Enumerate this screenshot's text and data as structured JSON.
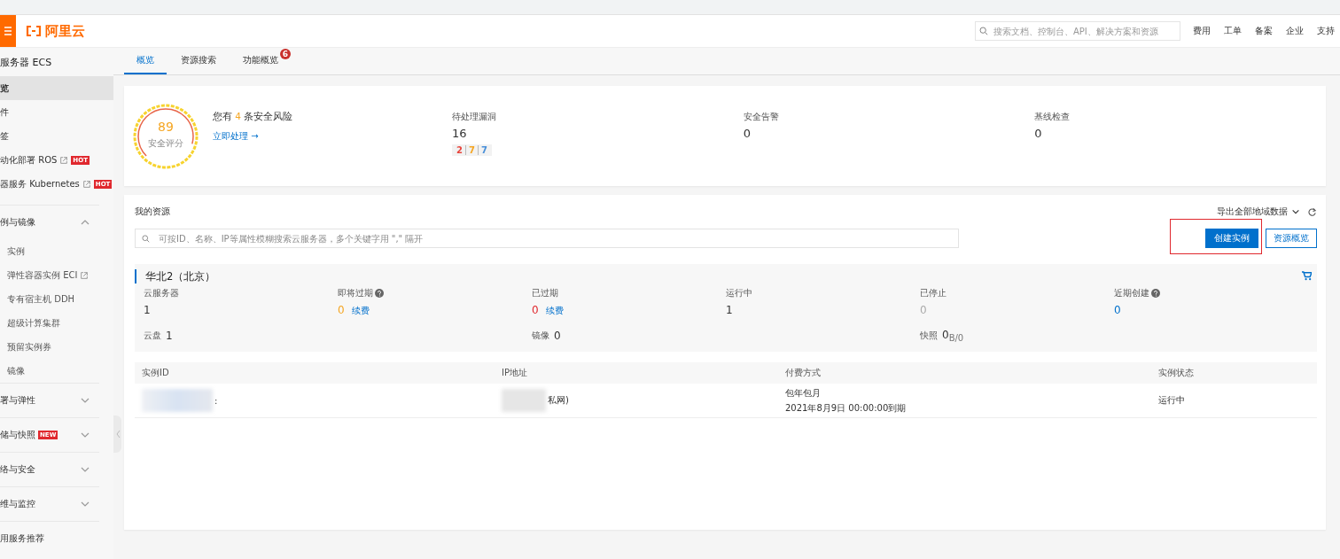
{
  "header": {
    "logo": "阿里云",
    "search": {
      "placeholder": "搜索文档、控制台、API、解决方案和资源"
    },
    "links": [
      "费用",
      "工单",
      "备案",
      "企业",
      "支持"
    ]
  },
  "sidebar": {
    "title": "服务器 ECS",
    "items": [
      {
        "label": "览",
        "selected": true
      },
      {
        "label": "件",
        "selected": false
      },
      {
        "label": "签",
        "selected": false
      },
      {
        "label": "动化部署 ROS",
        "external": true,
        "badge": "HOT",
        "selected": false
      },
      {
        "label": "器服务 Kubernetes",
        "external": true,
        "badge": "HOT",
        "selected": false
      }
    ],
    "sections": [
      {
        "label": "例与镜像",
        "expanded": true,
        "children": [
          {
            "label": "实例",
            "selected": false
          },
          {
            "label": "弹性容器实例 ECI",
            "external": true,
            "selected": false
          },
          {
            "label": "专有宿主机 DDH",
            "selected": false
          },
          {
            "label": "超级计算集群",
            "selected": false
          },
          {
            "label": "预留实例券",
            "selected": false
          },
          {
            "label": "镜像",
            "selected": false
          }
        ]
      },
      {
        "label": "署与弹性",
        "expanded": false
      },
      {
        "label": "储与快照",
        "badge": "NEW",
        "expanded": false
      },
      {
        "label": "络与安全",
        "expanded": false
      },
      {
        "label": "维与监控",
        "expanded": false
      }
    ],
    "footer": "用服务推荐"
  },
  "tabs": [
    {
      "label": "概览",
      "selected": true
    },
    {
      "label": "资源搜索",
      "selected": false
    },
    {
      "label": "功能概览",
      "selected": false,
      "badge": "6"
    }
  ],
  "security": {
    "score": "89",
    "score_label": "安全评分",
    "level": 0.89,
    "risk_prefix": "您有",
    "risk_count": "4",
    "risk_suffix": "条安全风险",
    "action": "立即处理 →",
    "stats": [
      {
        "label": "待处理漏洞",
        "value": "16",
        "breakdown": [
          {
            "value": "2",
            "color": "#e8453c"
          },
          {
            "value": "7",
            "color": "#f5a623"
          },
          {
            "value": "7",
            "color": "#4a90d9"
          }
        ]
      },
      {
        "label": "安全告警",
        "value": "0"
      },
      {
        "label": "基线检查",
        "value": "0"
      }
    ]
  },
  "resources": {
    "title": "我的资源",
    "export": "导出全部地域数据",
    "search": {
      "placeholder": "可按ID、名称、IP等属性模糊搜索云服务器，多个关键字用 \",\" 隔开"
    },
    "buttons": [
      {
        "label": "创建实例",
        "kind": "primary",
        "highlighted": true
      },
      {
        "label": "资源概览",
        "kind": "secondary",
        "highlighted": false
      }
    ],
    "region": {
      "name": "华北2（北京）",
      "stats": [
        {
          "label": "云服务器",
          "value": "1",
          "color": "#333333",
          "help": false
        },
        {
          "label": "即将过期",
          "value": "0",
          "color": "#f5a623",
          "help": true,
          "action": "续费"
        },
        {
          "label": "已过期",
          "value": "0",
          "color": "#e0282e",
          "help": false,
          "action": "续费"
        },
        {
          "label": "运行中",
          "value": "1",
          "color": "#333333",
          "help": false
        },
        {
          "label": "已停止",
          "value": "0",
          "color": "#aaaaaa",
          "help": false
        },
        {
          "label": "近期创建",
          "value": "0",
          "color": "#0070cc",
          "help": true
        }
      ],
      "totals": [
        {
          "label": "云盘",
          "value": "1"
        },
        {
          "label": "镜像",
          "value": "0"
        },
        {
          "label": "快照",
          "value": "0",
          "sub": "B/0"
        }
      ]
    },
    "table": {
      "columns": [
        "实例ID",
        "IP地址",
        "付费方式",
        "实例状态"
      ],
      "rows": [
        {
          "cells": [
            {
              "kind": "redacted",
              "text": ":"
            },
            {
              "kind": "redacted",
              "text": "私网)"
            },
            {
              "kind": "lines",
              "lines": [
                "包年包月",
                "2021年8月9日 00:00:00到期"
              ]
            },
            {
              "kind": "text",
              "text": "运行中"
            }
          ]
        }
      ]
    }
  }
}
